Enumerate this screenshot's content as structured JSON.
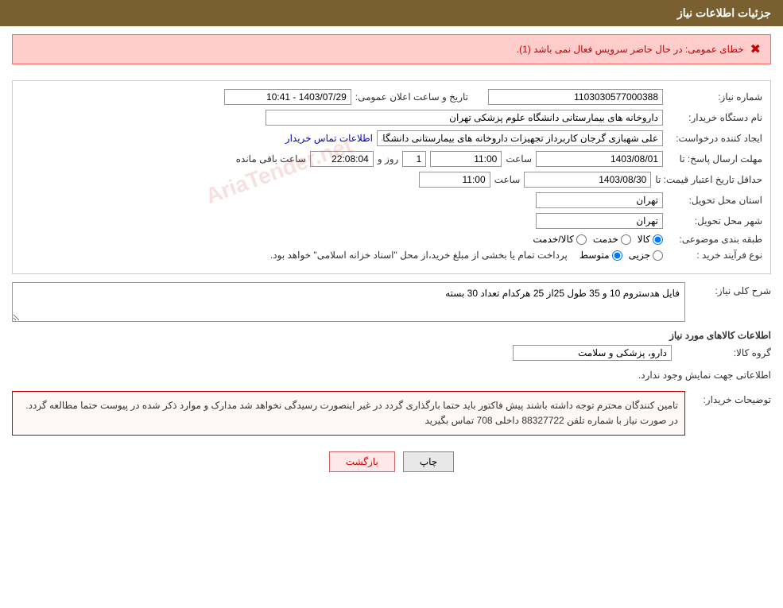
{
  "header": {
    "title": "جزئیات اطلاعات نیاز"
  },
  "error": {
    "icon": "✖",
    "message": "خطای عمومی: در حال حاضر سرویس فعال نمی باشد (1)."
  },
  "form": {
    "fields": {
      "need_number_label": "شماره نیاز:",
      "need_number_value": "1103030577000388",
      "date_label": "تاریخ و ساعت اعلان عمومی:",
      "date_value": "1403/07/29 - 10:41",
      "buyer_name_label": "نام دستگاه خریدار:",
      "buyer_name_value": "داروخانه های بیمارستانی دانشگاه علوم پزشکی تهران",
      "creator_label": "ایجاد کننده درخواست:",
      "creator_value": "علی شهبازی گرجان کاربرداز تجهیزات داروخانه های بیمارستانی دانشگاه علوم پ",
      "creator_link": "اطلاعات تماس خریدار",
      "deadline_label": "مهلت ارسال پاسخ: تا",
      "deadline_date": "1403/08/01",
      "deadline_time_label": "ساعت",
      "deadline_time": "11:00",
      "deadline_days_label": "روز و",
      "deadline_days": "1",
      "deadline_remaining_label": "ساعت باقی مانده",
      "deadline_remaining": "22:08:04",
      "price_date_label": "حداقل تاریخ اعتبار قیمت: تا",
      "price_date": "1403/08/30",
      "price_time_label": "ساعت",
      "price_time": "11:00",
      "province_label": "استان محل تحویل:",
      "province_value": "تهران",
      "city_label": "شهر محل تحویل:",
      "city_value": "تهران",
      "category_label": "طبقه بندی موضوعی:",
      "category_kala": "کالا",
      "category_service": "خدمت",
      "category_kala_service": "کالا/خدمت",
      "buy_type_label": "نوع فرآیند خرید :",
      "buy_type_jozi": "جزیی",
      "buy_type_motavaset": "متوسط",
      "buy_type_note": "پرداخت تمام یا بخشی از مبلغ خرید،از محل \"اسناد خزانه اسلامی\" خواهد بود."
    },
    "description": {
      "title": "شرح کلی نیاز:",
      "value": "فایل هدستروم 10 و 35 طول 25از 25 هرکدام تعداد 30 بسته"
    },
    "goods_info": {
      "title": "اطلاعات کالاهای مورد نیاز",
      "group_label": "گروه کالا:",
      "group_value": "دارو، پزشکی و سلامت",
      "no_data": "اطلاعاتی جهت نمایش وجود ندارد."
    },
    "buyer_notes": {
      "label": "توضیحات خریدار:",
      "value": "تامین کنندگان محترم توجه داشته باشند پیش فاکتور باید حتما بارگذاری گردد در غیر اینصورت رسیدگی نخواهد شد مدارک و موارد ذکر شده در پیوست حتما مطالعه گردد. در صورت نیاز با شماره تلفن 88327722 داخلی 708 تماس بگیرید"
    }
  },
  "buttons": {
    "print": "چاپ",
    "back": "بازگشت"
  },
  "watermark": "AriaTender.net"
}
